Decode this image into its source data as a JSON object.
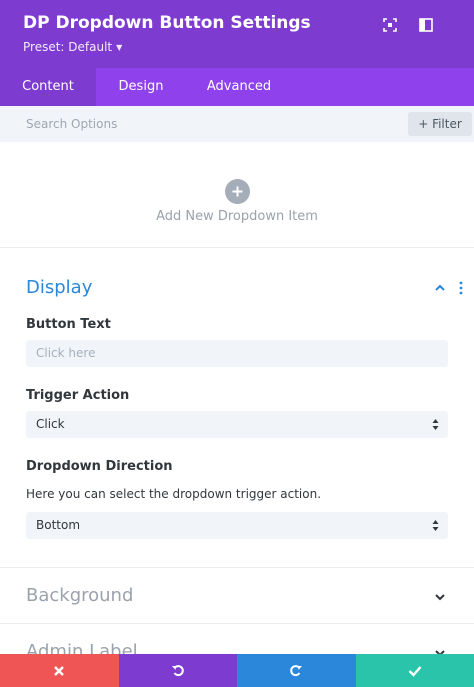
{
  "header": {
    "title": "DP Dropdown Button Settings",
    "preset_label": "Preset: Default",
    "icons": [
      "screen-fit-icon",
      "sidebar-layout-icon"
    ]
  },
  "tabs": [
    {
      "label": "Content",
      "active": true
    },
    {
      "label": "Design",
      "active": false
    },
    {
      "label": "Advanced",
      "active": false
    }
  ],
  "search": {
    "placeholder": "Search Options",
    "filter_label": "+ Filter"
  },
  "add_item": {
    "label": "Add New Dropdown Item"
  },
  "display_section": {
    "title": "Display",
    "button_text": {
      "label": "Button Text",
      "placeholder": "Click here"
    },
    "trigger_action": {
      "label": "Trigger Action",
      "value": "Click"
    },
    "dropdown_direction": {
      "label": "Dropdown Direction",
      "description": "Here you can select the dropdown trigger action.",
      "value": "Bottom"
    }
  },
  "collapsed_sections": [
    {
      "title": "Background"
    },
    {
      "title": "Admin Label"
    }
  ],
  "footer": {
    "buttons": [
      {
        "name": "discard",
        "icon": "close-icon",
        "color": "#ef5555"
      },
      {
        "name": "undo",
        "icon": "undo-icon",
        "color": "#7e3bd0"
      },
      {
        "name": "redo",
        "icon": "redo-icon",
        "color": "#2b87da"
      },
      {
        "name": "save",
        "icon": "check-icon",
        "color": "#29c4a9"
      }
    ]
  },
  "colors": {
    "header": "#7e3bd0",
    "tabs": "#8f42ec",
    "accent_blue": "#2b87da"
  }
}
